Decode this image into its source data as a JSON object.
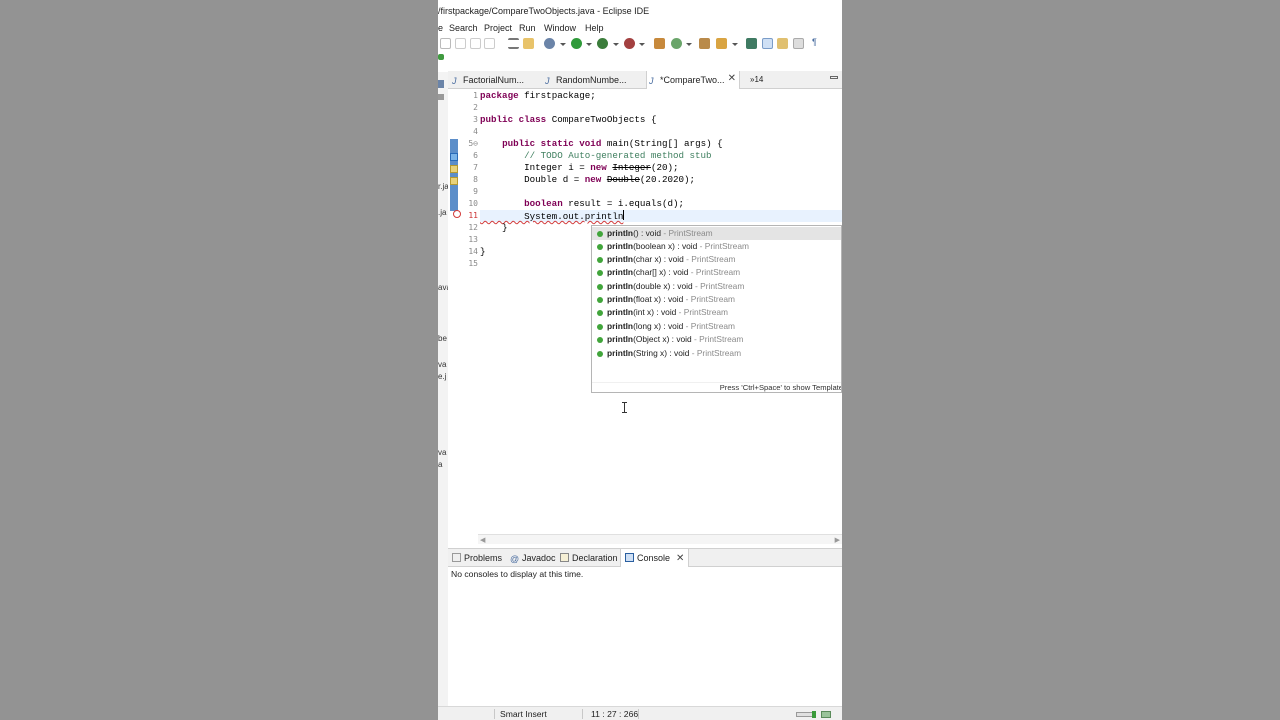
{
  "window": {
    "title": "/firstpackage/CompareTwoObjects.java - Eclipse IDE"
  },
  "menu": {
    "items": [
      "e",
      "Search",
      "Project",
      "Run",
      "Window",
      "Help"
    ]
  },
  "side_strip": {
    "fragments": [
      "r.ja",
      ".ja",
      "ava",
      "be",
      "va",
      "e.j",
      "va",
      "a"
    ]
  },
  "editor_tabs": [
    {
      "label": "FactorialNum...",
      "active": false
    },
    {
      "label": "RandomNumbe...",
      "active": false
    },
    {
      "label": "*CompareTwo...",
      "active": true
    }
  ],
  "editor_tabs_overflow": "»14",
  "code": {
    "line_numbers": [
      "1",
      "2",
      "3",
      "4",
      "5⊖",
      "6",
      "7",
      "8",
      "9",
      "10",
      "11",
      "12",
      "13",
      "14",
      "15"
    ],
    "lines": {
      "l1_kw": "package",
      "l1_rest": " firstpackage;",
      "l3_kw1": "public",
      "l3_sp": " ",
      "l3_kw2": "class",
      "l3_rest": " CompareTwoObjects {",
      "l5_indent": "    ",
      "l5_kw1": "public",
      "l5_sp1": " ",
      "l5_kw2": "static",
      "l5_sp2": " ",
      "l5_kw3": "void",
      "l5_rest": " main(String[] args) {",
      "l6_indent": "        ",
      "l6_comment": "// TODO Auto-generated method stub",
      "l7_pre": "        Integer i = ",
      "l7_kw": "new",
      "l7_sp": " ",
      "l7_dep": "Integer",
      "l7_rest": "(20);",
      "l8_pre": "        Double d = ",
      "l8_kw": "new",
      "l8_sp": " ",
      "l8_dep": "Double",
      "l8_rest": "(20.2020);",
      "l10_indent": "        ",
      "l10_kw": "boolean",
      "l10_rest": " result = i.equals(d);",
      "l11": "        System.out.println",
      "l12": "    }",
      "l14": "}"
    }
  },
  "content_assist": {
    "proposals": [
      {
        "method": "println",
        "sig": "() : void",
        "cls": " - PrintStream"
      },
      {
        "method": "println",
        "sig": "(boolean x) : void",
        "cls": " - PrintStream"
      },
      {
        "method": "println",
        "sig": "(char x) : void",
        "cls": " - PrintStream"
      },
      {
        "method": "println",
        "sig": "(char[] x) : void",
        "cls": " - PrintStream"
      },
      {
        "method": "println",
        "sig": "(double x) : void",
        "cls": " - PrintStream"
      },
      {
        "method": "println",
        "sig": "(float x) : void",
        "cls": " - PrintStream"
      },
      {
        "method": "println",
        "sig": "(int x) : void",
        "cls": " - PrintStream"
      },
      {
        "method": "println",
        "sig": "(long x) : void",
        "cls": " - PrintStream"
      },
      {
        "method": "println",
        "sig": "(Object x) : void",
        "cls": " - PrintStream"
      },
      {
        "method": "println",
        "sig": "(String x) : void",
        "cls": " - PrintStream"
      }
    ],
    "footer": "Press 'Ctrl+Space' to show Template"
  },
  "bottom_tabs": [
    {
      "label": "Problems",
      "active": false
    },
    {
      "label": "Javadoc",
      "active": false
    },
    {
      "label": "Declaration",
      "active": false
    },
    {
      "label": "Console",
      "active": true
    }
  ],
  "console_message": "No consoles to display at this time.",
  "status": {
    "insert_mode": "Smart Insert",
    "position": "11 : 27 : 266"
  },
  "colors": {
    "keyword": "#7f0055",
    "comment": "#3f7f5f",
    "proposal_icon": "#41a53b",
    "background": "#939393"
  }
}
